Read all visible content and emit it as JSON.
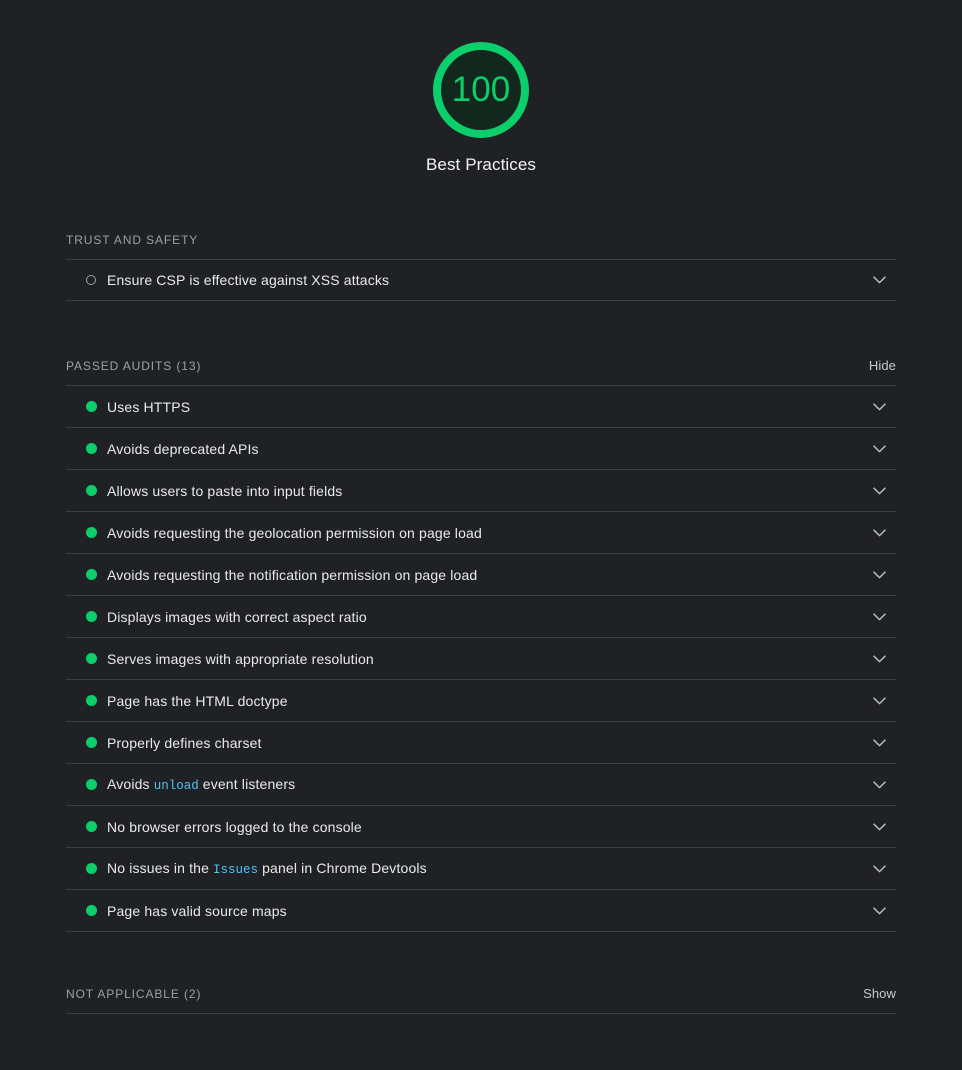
{
  "gauge": {
    "score": "100",
    "label": "Best Practices",
    "ring_color": "#0CCE6B",
    "fill_color": "#12281f",
    "text_color": "#0CCE6B"
  },
  "sections": [
    {
      "id": "trust-and-safety",
      "title": "TRUST AND SAFETY",
      "toggle": "",
      "audits": [
        {
          "status": "info",
          "title": "Ensure CSP is effective against XSS attacks"
        }
      ]
    },
    {
      "id": "passed-audits",
      "title": "PASSED AUDITS (13)",
      "toggle": "Hide",
      "audits": [
        {
          "status": "pass",
          "title": "Uses HTTPS"
        },
        {
          "status": "pass",
          "title": "Avoids deprecated APIs"
        },
        {
          "status": "pass",
          "title": "Allows users to paste into input fields"
        },
        {
          "status": "pass",
          "title": "Avoids requesting the geolocation permission on page load"
        },
        {
          "status": "pass",
          "title": "Avoids requesting the notification permission on page load"
        },
        {
          "status": "pass",
          "title": "Displays images with correct aspect ratio"
        },
        {
          "status": "pass",
          "title": "Serves images with appropriate resolution"
        },
        {
          "status": "pass",
          "title": "Page has the HTML doctype"
        },
        {
          "status": "pass",
          "title": "Properly defines charset"
        },
        {
          "status": "pass",
          "title": "Avoids ",
          "code": "unload",
          "title_after": " event listeners"
        },
        {
          "status": "pass",
          "title": "No browser errors logged to the console"
        },
        {
          "status": "pass",
          "title": "No issues in the ",
          "code": "Issues",
          "title_after": " panel in Chrome Devtools"
        },
        {
          "status": "pass",
          "title": "Page has valid source maps"
        }
      ]
    },
    {
      "id": "not-applicable",
      "title": "NOT APPLICABLE (2)",
      "toggle": "Show",
      "audits": []
    }
  ],
  "colors": {
    "background": "#202124",
    "pass_green": "#0CCE6B",
    "divider": "#3c4043",
    "muted_text": "#9aa0a6",
    "body_text": "#e8eaed",
    "code_blue": "#4ec3f7"
  }
}
